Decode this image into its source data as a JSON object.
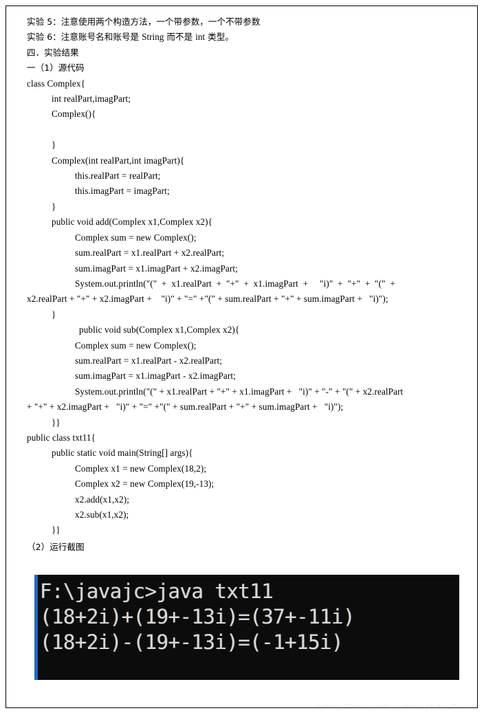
{
  "document": {
    "notes": [
      "实验 5：注意使用两个构造方法，一个带参数，一个不带参数",
      "实验 6：注意账号名和账号是 String 而不是 int 类型。"
    ],
    "note5_cn_a": "实验 5：注意使用两个构造方法，一个带参数，一个不带参数",
    "note6_part1": "实验 6：注意账号名和账号是 ",
    "note6_latin1": "String",
    "note6_part2": " 而不是 ",
    "note6_latin2": "int",
    "note6_part3": " 类型。",
    "heading_section": "四．实验结果",
    "heading_sub": "一（1）源代码",
    "screenshot_caption": "（2）运行截图",
    "code_lines": [
      "class Complex{",
      "int realPart,imagPart;",
      "Complex(){",
      "",
      "}",
      "Complex(int realPart,int imagPart){",
      "this.realPart = realPart;",
      "this.imagPart = imagPart;",
      "}",
      "public void add(Complex x1,Complex x2){",
      "Complex sum = new Complex();",
      "sum.realPart = x1.realPart + x2.realPart;",
      "sum.imagPart = x1.imagPart + x2.imagPart;",
      "System.out.println(\"(\"  +  x1.realPart  +  \"+\"  +  x1.imagPart  +     \"i)\"  +  \"+\"  +  \"(\"  +",
      "x2.realPart + \"+\" + x2.imagPart +    \"i)\" + \"=\" +\"(\" + sum.realPart + \"+\" + sum.imagPart +   \"i)\");",
      "}",
      "public void sub(Complex x1,Complex x2){",
      "Complex sum = new Complex();",
      "sum.realPart = x1.realPart - x2.realPart;",
      "sum.imagPart = x1.imagPart - x2.imagPart;",
      "System.out.println(\"(\" + x1.realPart + \"+\" + x1.imagPart +   \"i)\" + \"-\" + \"(\" + x2.realPart",
      "+ \"+\" + x2.imagPart +   \"i)\" + \"=\" +\"(\" + sum.realPart + \"+\" + sum.imagPart +   \"i)\");",
      "}}",
      "public class txt11{",
      "public static void main(String[] args){",
      "Complex x1 = new Complex(18,2);",
      "Complex x2 = new Complex(19,-13);",
      "x2.add(x1,x2);",
      "x2.sub(x1,x2);",
      "}}"
    ]
  },
  "terminal": {
    "prompt_line": "F:\\javajc>java txt11",
    "output_line_1": "(18+2i)+(19+-13i)=(37+-11i)",
    "output_line_2": "(18+2i)-(19+-13i)=(-1+15i)",
    "background_color": "#0c0c0c",
    "text_color": "#d8d8d8",
    "accent_bar_color": "#1b6ac9"
  },
  "watermark": {
    "text": "https://blog.csdn.net/want_to_fly_"
  }
}
